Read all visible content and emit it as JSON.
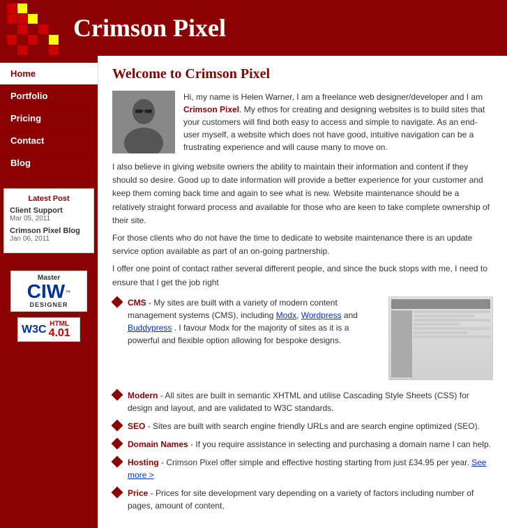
{
  "header": {
    "title": "Crimson Pixel",
    "mosaic_colors": [
      "#8b0000",
      "#cc0000",
      "#8b0000",
      "#8b0000",
      "#8b0000",
      "#cc0000",
      "#ffff00",
      "#cc0000",
      "#8b0000",
      "#8b0000",
      "#8b0000",
      "#cc0000",
      "#8b0000",
      "#cc0000",
      "#8b0000",
      "#8b0000",
      "#8b0000",
      "#cc0000",
      "#8b0000",
      "#cc0000",
      "#cc0000",
      "#8b0000",
      "#8b0000",
      "#ffff00",
      "#8b0000"
    ]
  },
  "nav": {
    "items": [
      {
        "label": "Home",
        "active": true,
        "id": "home"
      },
      {
        "label": "Portfolio",
        "active": false,
        "id": "portfolio"
      },
      {
        "label": "Pricing",
        "active": false,
        "id": "pricing"
      },
      {
        "label": "Contact",
        "active": false,
        "id": "contact"
      },
      {
        "label": "Blog",
        "active": false,
        "id": "blog"
      }
    ]
  },
  "sidebar": {
    "latest_post_title": "Latest Post",
    "posts": [
      {
        "title": "Client Support",
        "date": "Mar 05, 2011"
      },
      {
        "title": "Crimson Pixel Blog",
        "date": "Jan 06, 2011"
      }
    ],
    "ciw": {
      "master": "Master",
      "letters": "CIW",
      "tm": "™",
      "designer": "DESIGNER"
    },
    "w3c": {
      "text": "W3C",
      "html_label": "HTML",
      "version": "4.01"
    }
  },
  "main": {
    "page_title": "Welcome to Crimson Pixel",
    "intro_para1": "Hi, my name is Helen Warner, I am a freelance web designer/developer and I am ",
    "crimson_link": "Crimson Pixel",
    "intro_para1_end": ". My ethos for creating and designing websites is to build sites that your customers will find both easy to access and simple to navigate. As an end-user myself, a website which does not have good, intuitive navigation can be a frustrating experience and will cause many to move on.",
    "intro_para2": "I also believe in giving website owners the ability to maintain their information and content if they should so desire. Good up to date information will provide a better experience for your customer and keep them coming back time and again to see what is new. Website maintenance should be a relatively straight forward process and available for those who are keen to take complete ownership of their site.",
    "intro_para3": "For those clients who do not have the time to dedicate to website maintenance there is an update service option available as part of an on-going partnership.",
    "intro_para4": "I offer one point of contact rather several different people, and since the buck stops with me, I need to ensure that I get the job right",
    "features": [
      {
        "label": "CMS",
        "text": " - My sites are built with a variety of modern content management systems (CMS), including ",
        "links": [
          "Modx",
          "Wordpress",
          "Buddypress"
        ],
        "text2": ". I favour Modx for the majority of sites as it is a powerful and flexible option allowing for bespoke designs."
      },
      {
        "label": "Modern",
        "text": " - All sites are built in semantic XHTML and utilise Cascading Style Sheets (CSS) for design and layout, and are validated to W3C standards."
      },
      {
        "label": "SEO",
        "text": " - Sites are built with search engine friendly URLs and are search engine optimized (SEO)."
      },
      {
        "label": "Domain Names",
        "text": " - If you require assistance in selecting and purchasing a domain name I can help."
      },
      {
        "label": "Hosting",
        "text": " - Crimson Pixel offer simple and effective hosting starting from just £34.95 per year. ",
        "see_more": "See more >"
      },
      {
        "label": "Price",
        "text": " - Prices for site development vary depending on a variety of factors including number of pages, amount of content,"
      }
    ]
  }
}
